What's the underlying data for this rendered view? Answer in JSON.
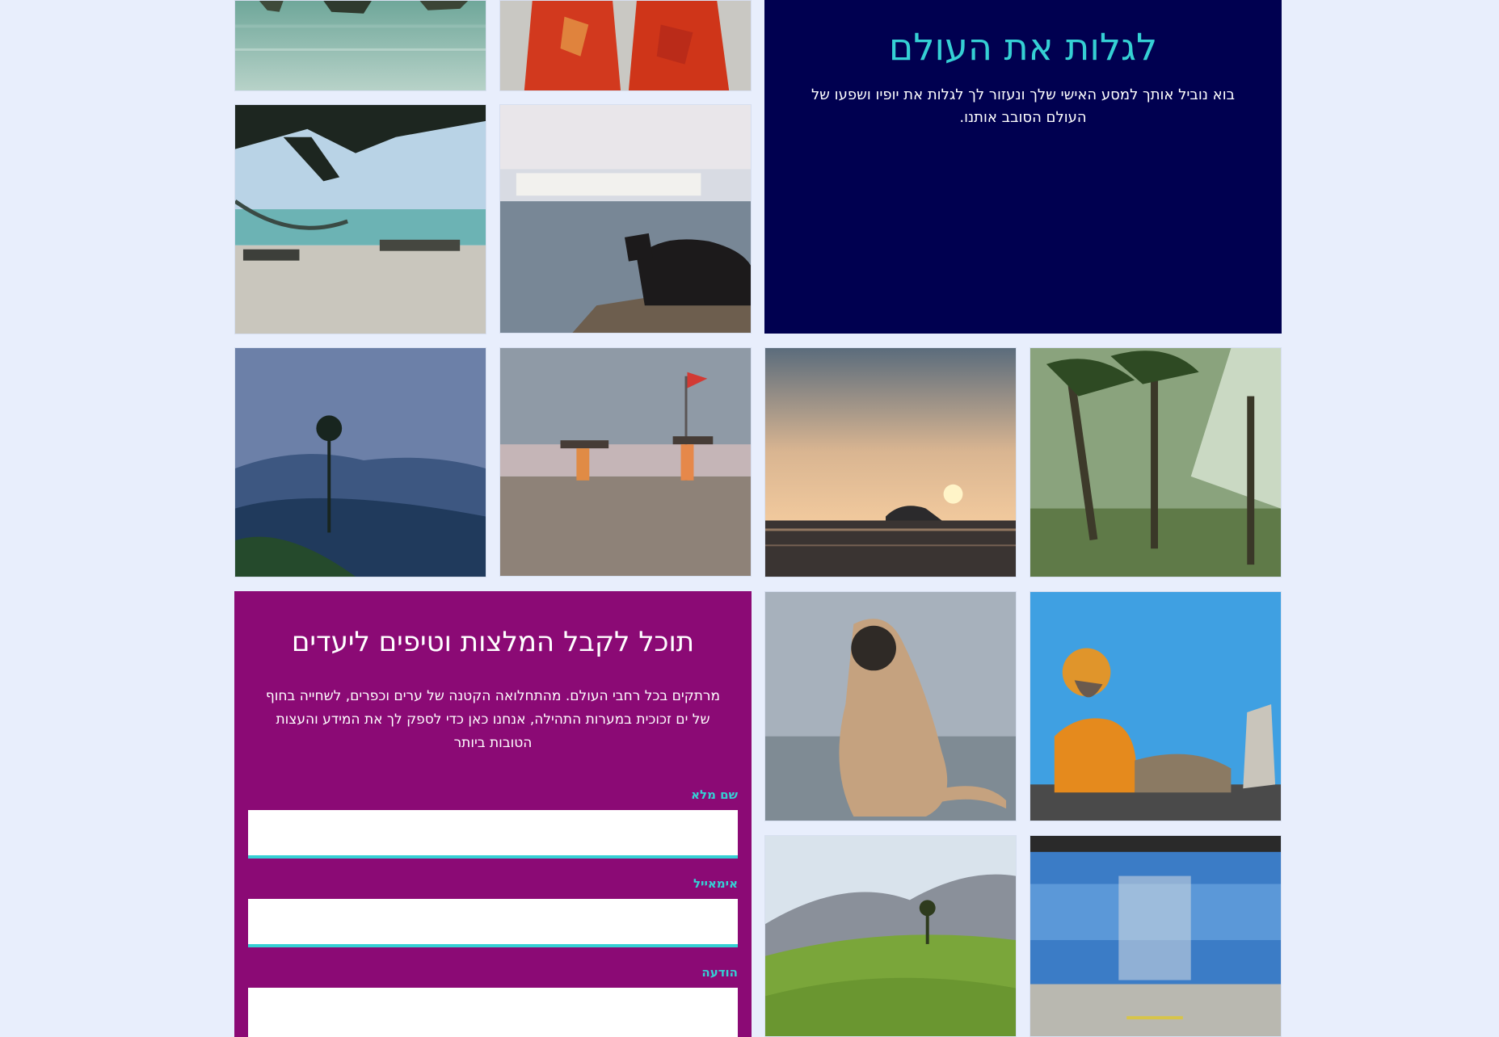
{
  "hero": {
    "title": "לגלות את העולם",
    "text": "בוא נוביל אותך למסע האישי שלך ונעזור לך לגלות את יופיו ושפעו של העולם הסובב אותנו."
  },
  "contact": {
    "title": "תוכל לקבל המלצות וטיפים ליעדים",
    "text": "מרתקים בכל רחבי העולם. מהתחלואה הקטנה של ערים וכפרים, לשחייה בחוף של ים זכוכית במערות התהילה, אנחנו כאן כדי לספק לך את המידע והעצות הטובות ביותר",
    "fields": {
      "name_label": "שם מלא",
      "email_label": "אימאייל",
      "message_label": "הודעה"
    }
  },
  "colors": {
    "background": "#e8eefc",
    "hero_bg": "#000050",
    "accent": "#35d0d4",
    "contact_bg": "#8b0a75"
  }
}
